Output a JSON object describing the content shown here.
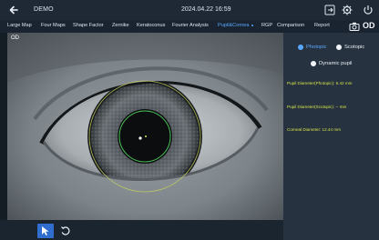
{
  "header": {
    "title": "DEMO",
    "datetime": "2024.04.22 16:59",
    "icons": [
      "back-icon",
      "export-icon",
      "settings-icon",
      "power-icon"
    ]
  },
  "menu": {
    "items": [
      {
        "label": "Large Map"
      },
      {
        "label": "Four Maps"
      },
      {
        "label": "Shape Factor"
      },
      {
        "label": "Zernike"
      },
      {
        "label": "Keratoconus"
      },
      {
        "label": "Fourier Analysis"
      },
      {
        "label": "Pupil&Cornea"
      },
      {
        "label": "RGP"
      },
      {
        "label": "Comparison"
      },
      {
        "label": "Report"
      }
    ],
    "active": "Pupil&Cornea",
    "eye_side": "OD",
    "camera_icon": "camera-icon"
  },
  "image": {
    "eye_label": "OD"
  },
  "toolbar": {
    "tools": [
      "select-tool-icon",
      "rotate-icon"
    ],
    "selected": "select-tool-icon"
  },
  "panel": {
    "modes": [
      {
        "label": "Photopic",
        "active": true
      },
      {
        "label": "Scotopic",
        "active": false
      },
      {
        "label": "Dynamic pupil",
        "active": false
      }
    ],
    "measurements": [
      {
        "text": "Pupil Diameter(Photopic): 5.42 mm"
      },
      {
        "text": "Pupil Diameter(Scotopic): -- mm"
      },
      {
        "text": "Corneal Diameter: 12.44 mm"
      }
    ],
    "accent_color": "#5aa7ff",
    "measure_color": "#d7e34a"
  }
}
